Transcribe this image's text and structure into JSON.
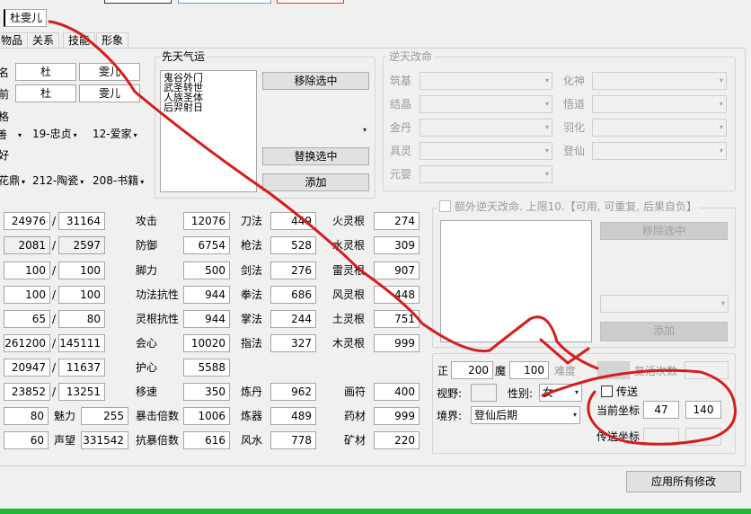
{
  "header": {
    "title_tab": "杜雯儿"
  },
  "tabs": [
    "物品",
    "关系",
    "技能",
    "形象"
  ],
  "basic": {
    "row_labels": [
      "名",
      "前",
      "格",
      "善",
      "好",
      "花鼎"
    ],
    "name_surname": "杜",
    "name_given": "雯儿",
    "former_surname": "杜",
    "former_given": "雯儿",
    "personality_1": "19-忠贞",
    "personality_2": "12-爱家",
    "hobby_1": "212-陶瓷",
    "hobby_2": "208-书籍"
  },
  "innate_luck": {
    "title": "先天气运",
    "items": [
      "鬼谷外门",
      "武圣转世",
      "人族圣体",
      "后羿射日"
    ],
    "remove_label": "移除选中",
    "replace_label": "替换选中",
    "add_label": "添加"
  },
  "fate": {
    "title": "逆天改命",
    "left_labels": [
      "筑基",
      "结晶",
      "金丹",
      "具灵",
      "元婴"
    ],
    "right_labels": [
      "化神",
      "悟道",
      "羽化",
      "登仙"
    ]
  },
  "extra_fate": {
    "title": "额外逆天改命. 上限10.【可用, 可重复, 后果自负】",
    "remove_label": "移除选中",
    "add_label": "添加"
  },
  "vitals": [
    [
      "24976",
      "31164"
    ],
    [
      "2081",
      "2597"
    ],
    [
      "100",
      "100"
    ],
    [
      "100",
      "100"
    ],
    [
      "65",
      "80"
    ],
    [
      "261200",
      "145111"
    ],
    [
      "20947",
      "11637"
    ],
    [
      "23852",
      "13251"
    ]
  ],
  "separator": "/",
  "bottom_left": {
    "first_value": "80",
    "charm_label": "魅力",
    "charm_value": "255",
    "second_value": "60",
    "fame_label": "声望",
    "fame_value": "331542"
  },
  "combat": [
    {
      "label": "攻击",
      "value": "12076"
    },
    {
      "label": "防御",
      "value": "6754"
    },
    {
      "label": "脚力",
      "value": "500"
    },
    {
      "label": "功法抗性",
      "value": "944"
    },
    {
      "label": "灵根抗性",
      "value": "944"
    },
    {
      "label": "会心",
      "value": "10020"
    },
    {
      "label": "护心",
      "value": "5588"
    },
    {
      "label": "移速",
      "value": "350"
    },
    {
      "label": "暴击倍数",
      "value": "1006"
    },
    {
      "label": "抗暴倍数",
      "value": "616"
    }
  ],
  "weapons": [
    {
      "label": "刀法",
      "value": "449"
    },
    {
      "label": "枪法",
      "value": "528"
    },
    {
      "label": "剑法",
      "value": "276"
    },
    {
      "label": "拳法",
      "value": "686"
    },
    {
      "label": "掌法",
      "value": "244"
    },
    {
      "label": "指法",
      "value": "327"
    }
  ],
  "roots": [
    {
      "label": "火灵根",
      "value": "274"
    },
    {
      "label": "水灵根",
      "value": "309"
    },
    {
      "label": "雷灵根",
      "value": "907"
    },
    {
      "label": "风灵根",
      "value": "448"
    },
    {
      "label": "土灵根",
      "value": "751"
    },
    {
      "label": "木灵根",
      "value": "999"
    }
  ],
  "crafts": [
    {
      "label": "炼丹",
      "value": "962"
    },
    {
      "label": "炼器",
      "value": "489"
    },
    {
      "label": "风水",
      "value": "778"
    }
  ],
  "arts": [
    {
      "label": "画符",
      "value": "400"
    },
    {
      "label": "药材",
      "value": "999"
    },
    {
      "label": "矿材",
      "value": "220"
    }
  ],
  "status": {
    "zheng_label": "正",
    "zheng_value": "200",
    "mo_label": "魔",
    "mo_value": "100",
    "difficulty_label": "难度",
    "reset_label": "复活次数",
    "vision_label": "视野:",
    "gender_label": "性别:",
    "gender_value": "女",
    "realm_label": "境界:",
    "realm_value": "登仙后期"
  },
  "teleport": {
    "checkbox_label": "传送",
    "current_label": "当前坐标",
    "current_x": "47",
    "current_y": "140",
    "target_label": "传送坐标"
  },
  "apply_label": "应用所有修改",
  "colors": {
    "annotation": "#d21e1e",
    "progress": "#1fb73a"
  }
}
